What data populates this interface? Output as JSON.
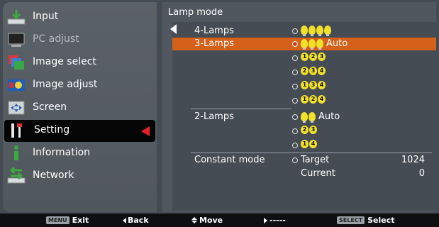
{
  "sidebar": {
    "items": [
      {
        "label": "Input",
        "icon": "input-icon"
      },
      {
        "label": "PC adjust",
        "icon": "pc-adjust-icon"
      },
      {
        "label": "Image select",
        "icon": "image-select-icon"
      },
      {
        "label": "Image adjust",
        "icon": "image-adjust-icon"
      },
      {
        "label": "Screen",
        "icon": "screen-icon"
      },
      {
        "label": "Setting",
        "icon": "setting-icon"
      },
      {
        "label": "Information",
        "icon": "information-icon"
      },
      {
        "label": "Network",
        "icon": "network-icon"
      }
    ],
    "active_index": 5
  },
  "panel": {
    "title": "Lamp mode",
    "rows": [
      {
        "name": "4-Lamps",
        "option": "",
        "bulbs": 4,
        "selected": false
      },
      {
        "name": "3-Lamps",
        "option": "Auto",
        "bulbs": 3,
        "selected": true
      },
      {
        "name": "",
        "option": "",
        "numbered": [
          "1",
          "2",
          "3"
        ],
        "selected": false
      },
      {
        "name": "",
        "option": "",
        "numbered": [
          "2",
          "3",
          "4"
        ],
        "selected": false
      },
      {
        "name": "",
        "option": "",
        "numbered": [
          "1",
          "3",
          "4"
        ],
        "selected": false
      },
      {
        "name": "",
        "option": "",
        "numbered": [
          "1",
          "2",
          "4"
        ],
        "selected": false
      },
      {
        "name": "2-Lamps",
        "option": "Auto",
        "bulbs": 2,
        "selected": false
      },
      {
        "name": "",
        "option": "",
        "numbered": [
          "2",
          "3"
        ],
        "selected": false
      },
      {
        "name": "",
        "option": "",
        "numbered": [
          "1",
          "4"
        ],
        "selected": false
      }
    ],
    "constant": {
      "name": "Constant mode",
      "target_label": "Target",
      "target_value": "1024",
      "current_label": "Current",
      "current_value": "0"
    }
  },
  "footer": {
    "menu_key": "MENU",
    "exit": "Exit",
    "back": "Back",
    "move": "Move",
    "next": "-----",
    "select_key": "SELECT",
    "select": "Select"
  },
  "colors": {
    "selected_row": "#d4601a",
    "pointer": "#e6212b",
    "bulb": "#f1e02a"
  }
}
